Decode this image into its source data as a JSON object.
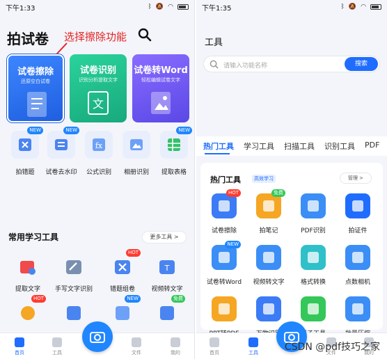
{
  "left": {
    "status": {
      "time": "下午1:33",
      "battery": "■"
    },
    "title": "拍试卷",
    "annotation": "选择擦除功能",
    "cards": [
      {
        "title": "试卷擦除",
        "subtitle": "还原空白试卷",
        "color": "#2f78f2"
      },
      {
        "title": "试卷识别",
        "subtitle": "识别分析提取文字",
        "color": "#1fbf8f"
      },
      {
        "title": "试卷转Word",
        "subtitle": "轻松编辑试卷文字",
        "color": "#6b5cf2"
      }
    ],
    "quick_tools": [
      {
        "label": "拍错题",
        "badge": "NEW",
        "icon": "x-doc-icon"
      },
      {
        "label": "试卷去水印",
        "badge": "NEW",
        "icon": "doc-list-icon"
      },
      {
        "label": "公式识别",
        "badge": "",
        "icon": "formula-icon"
      },
      {
        "label": "相册识别",
        "badge": "",
        "icon": "gallery-icon"
      },
      {
        "label": "提取表格",
        "badge": "NEW",
        "icon": "table-icon"
      }
    ],
    "section_title": "常用学习工具",
    "more_label": "更多工具 >",
    "common_tools": [
      {
        "label": "提取文字",
        "badge": "",
        "icon": "image-text-icon"
      },
      {
        "label": "手写文字识别",
        "badge": "",
        "icon": "handwriting-icon"
      },
      {
        "label": "错题组卷",
        "badge": "HOT",
        "icon": "x-doc-icon"
      },
      {
        "label": "视频转文字",
        "badge": "",
        "icon": "video-text-icon"
      },
      {
        "label": "",
        "badge": "HOT",
        "icon": "camera-icon"
      },
      {
        "label": "",
        "badge": "",
        "icon": "translate-icon"
      },
      {
        "label": "",
        "badge": "NEW",
        "icon": "word-icon"
      },
      {
        "label": "",
        "badge": "免费",
        "icon": "compress-icon"
      }
    ],
    "nav": {
      "home": "首页",
      "tools": "工具",
      "files": "文件",
      "mine": "我的"
    }
  },
  "right": {
    "status": {
      "time": "下午1:35"
    },
    "title": "工具",
    "search_placeholder": "请输入功能名称",
    "search_button": "搜索",
    "tabs": [
      "热门工具",
      "学习工具",
      "扫描工具",
      "识别工具",
      "PDF"
    ],
    "hot_title": "热门工具",
    "hot_tag": "高效学习",
    "manage_label": "管理 >",
    "tools": [
      {
        "label": "试卷擦除",
        "badge": "HOT",
        "color": "#3b7bf5",
        "icon": "eraser-doc-icon"
      },
      {
        "label": "拍笔记",
        "badge": "免费",
        "color": "#f5a623",
        "icon": "note-icon"
      },
      {
        "label": "PDF识别",
        "badge": "",
        "color": "#3b8ef5",
        "icon": "pdf-icon"
      },
      {
        "label": "拍证件",
        "badge": "",
        "color": "#1f6dff",
        "icon": "id-photo-icon"
      },
      {
        "label": "试卷转Word",
        "badge": "NEW",
        "color": "#3b8ef5",
        "icon": "word-icon"
      },
      {
        "label": "视频转文字",
        "badge": "",
        "color": "#3b8ef5",
        "icon": "video-text-icon"
      },
      {
        "label": "格式转换",
        "badge": "",
        "color": "#2fc0c9",
        "icon": "convert-icon"
      },
      {
        "label": "点数相机",
        "badge": "",
        "color": "#3b8ef5",
        "icon": "count-camera-icon"
      },
      {
        "label": "PPT转PDF",
        "badge": "",
        "color": "#f5a623",
        "icon": "ppt-icon"
      },
      {
        "label": "万物识别",
        "badge": "",
        "color": "#3b7bf5",
        "icon": "object-scan-icon"
      },
      {
        "label": "尺子工具",
        "badge": "",
        "color": "#34c759",
        "icon": "ruler-icon"
      },
      {
        "label": "批量压缩",
        "badge": "",
        "color": "#3b8ef5",
        "icon": "compress-icon"
      }
    ],
    "nav": {
      "home": "首页",
      "tools": "工具",
      "files": "文件",
      "mine": "我的"
    },
    "watermark": "CSDN @pdf技巧之家"
  }
}
